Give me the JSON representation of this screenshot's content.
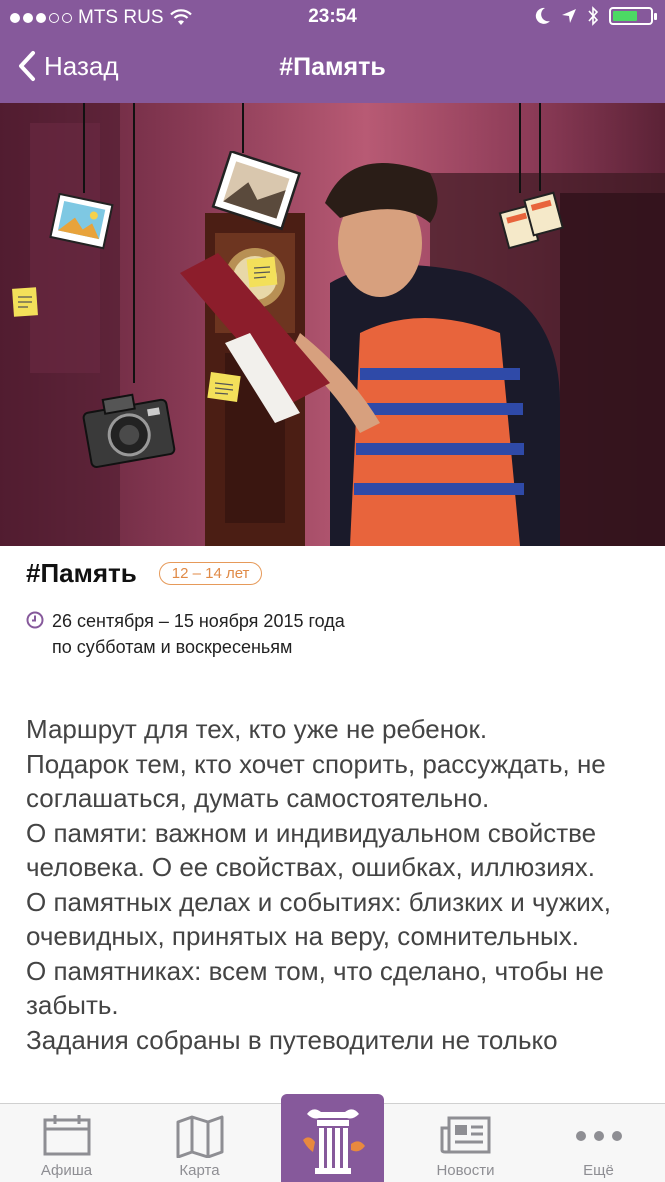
{
  "status_bar": {
    "carrier": "MTS RUS",
    "time": "23:54",
    "battery_level": 0.7,
    "battery_color": "#4cd964"
  },
  "nav": {
    "back_label": "Назад",
    "title": "#Память"
  },
  "hero": {
    "icons": [
      "photo-icon",
      "camera-icon",
      "picture-frame-icon",
      "tickets-icon",
      "sticky-note-icon"
    ]
  },
  "event": {
    "title": "#Память",
    "age_badge": "12 – 14 лет",
    "date_range": "26 сентября – 15 ноября 2015 года",
    "schedule": "по субботам и воскресеньям",
    "description": [
      "Маршрут для тех, кто уже не ребенок.",
      "Подарок тем, кто хочет спорить, рассуждать, не соглашаться, думать самостоятельно.",
      "О памяти: важном и индивидуальном свойстве человека. О ее свойствах, ошибках, иллюзиях.",
      "О памятных делах и событиях: близких и чужих, очевидных, принятых на веру, сомнительных.",
      "О памятниках: всем том, что сделано, чтобы не забыть.",
      "Задания собраны в путеводители не только"
    ]
  },
  "tabbar": {
    "tabs": [
      {
        "label": "Афиша",
        "icon": "calendar-icon"
      },
      {
        "label": "Карта",
        "icon": "map-icon"
      },
      {
        "label": "",
        "icon": "column-icon"
      },
      {
        "label": "Новости",
        "icon": "news-icon"
      },
      {
        "label": "Ещё",
        "icon": "more-icon"
      }
    ]
  },
  "colors": {
    "brand": "#86599b",
    "accent_orange": "#e08a46"
  }
}
